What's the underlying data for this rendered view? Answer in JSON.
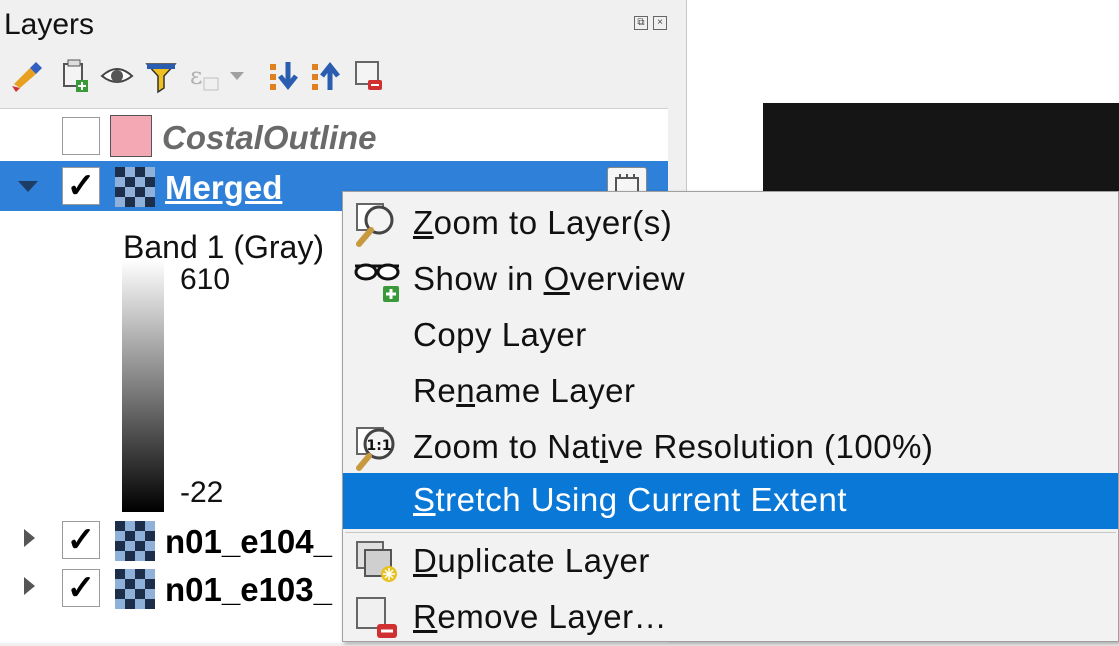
{
  "panel": {
    "title": "Layers",
    "toolbar": [
      "style-brush-icon",
      "add-group-icon",
      "eye-icon",
      "filter-icon",
      "expression-filter-icon",
      "expand-all-icon",
      "collapse-all-icon",
      "remove-layer-icon"
    ]
  },
  "layers": [
    {
      "name": "CostalOutline",
      "checked": false,
      "expanded": null,
      "style": "italic-gray"
    },
    {
      "name": "Merged",
      "checked": true,
      "expanded": true,
      "selected": true,
      "check_mark": "✓"
    },
    {
      "name": "n01_e104_",
      "checked": true,
      "expanded": false,
      "check_mark": "✓"
    },
    {
      "name": "n01_e103_",
      "checked": true,
      "expanded": false,
      "check_mark": "✓"
    }
  ],
  "legend": {
    "band": "Band 1 (Gray)",
    "max": "610",
    "min": "-22"
  },
  "context_menu": {
    "items": [
      {
        "pre": "",
        "u": "Z",
        "post": "oom to Layer(s)",
        "icon": "zoom-layer-icon"
      },
      {
        "pre": "Show in ",
        "u": "O",
        "post": "verview",
        "icon": "overview-glasses-icon"
      },
      {
        "pre": "Copy Layer",
        "u": "",
        "post": "",
        "icon": ""
      },
      {
        "pre": "Re",
        "u": "n",
        "post": "ame Layer",
        "icon": ""
      },
      {
        "pre": "Zoom to Nat",
        "u": "i",
        "post": "ve Resolution (100%)",
        "icon": "zoom-native-icon"
      },
      {
        "pre": "",
        "u": "S",
        "post": "tretch Using Current Extent",
        "icon": "",
        "highlighted": true
      },
      {
        "pre": "",
        "u": "D",
        "post": "uplicate Layer",
        "icon": "duplicate-layer-icon"
      },
      {
        "pre": "",
        "u": "R",
        "post": "emove Layer…",
        "icon": "remove-layer-icon"
      }
    ]
  },
  "colors": {
    "selection": "#2f80d8",
    "menu_highlight": "#0a78d7"
  }
}
